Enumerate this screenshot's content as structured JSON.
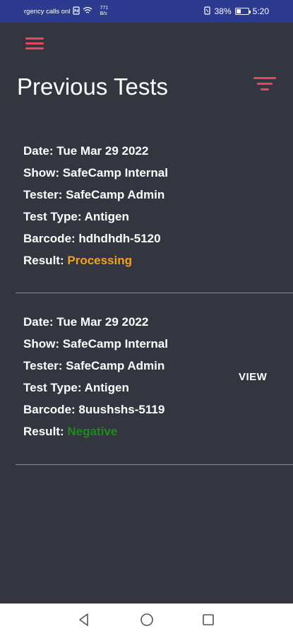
{
  "status_bar": {
    "left_text": "rgency calls onl",
    "speed_value": "771",
    "speed_unit": "B/s",
    "battery": "38%",
    "time": "5:20",
    "battery_level": 0.38
  },
  "header": {
    "title": "Previous Tests",
    "menu_icon": "hamburger-icon",
    "filter_icon": "filter-icon",
    "accent_color": "#e94462"
  },
  "tests": [
    {
      "date_label": "Date: Tue Mar 29 2022",
      "show_label": "Show: SafeCamp Internal",
      "tester_label": "Tester: SafeCamp Admin",
      "type_label": "Test Type: Antigen",
      "barcode_label": "Barcode: hdhdhdh-5120",
      "result_prefix": "Result:",
      "result_value": "Processing",
      "result_color": "#f4a11c"
    },
    {
      "date_label": "Date: Tue Mar 29 2022",
      "show_label": "Show: SafeCamp Internal",
      "tester_label": "Tester: SafeCamp Admin",
      "type_label": "Test Type: Antigen",
      "barcode_label": "Barcode: 8uushshs-5119",
      "result_prefix": "Result:",
      "result_value": "Negative",
      "result_color": "#1f8a1f",
      "view_label": "VIEW"
    }
  ],
  "nav_bar": {
    "back_icon": "back-triangle-icon",
    "home_icon": "home-circle-icon",
    "recents_icon": "recents-square-icon"
  }
}
